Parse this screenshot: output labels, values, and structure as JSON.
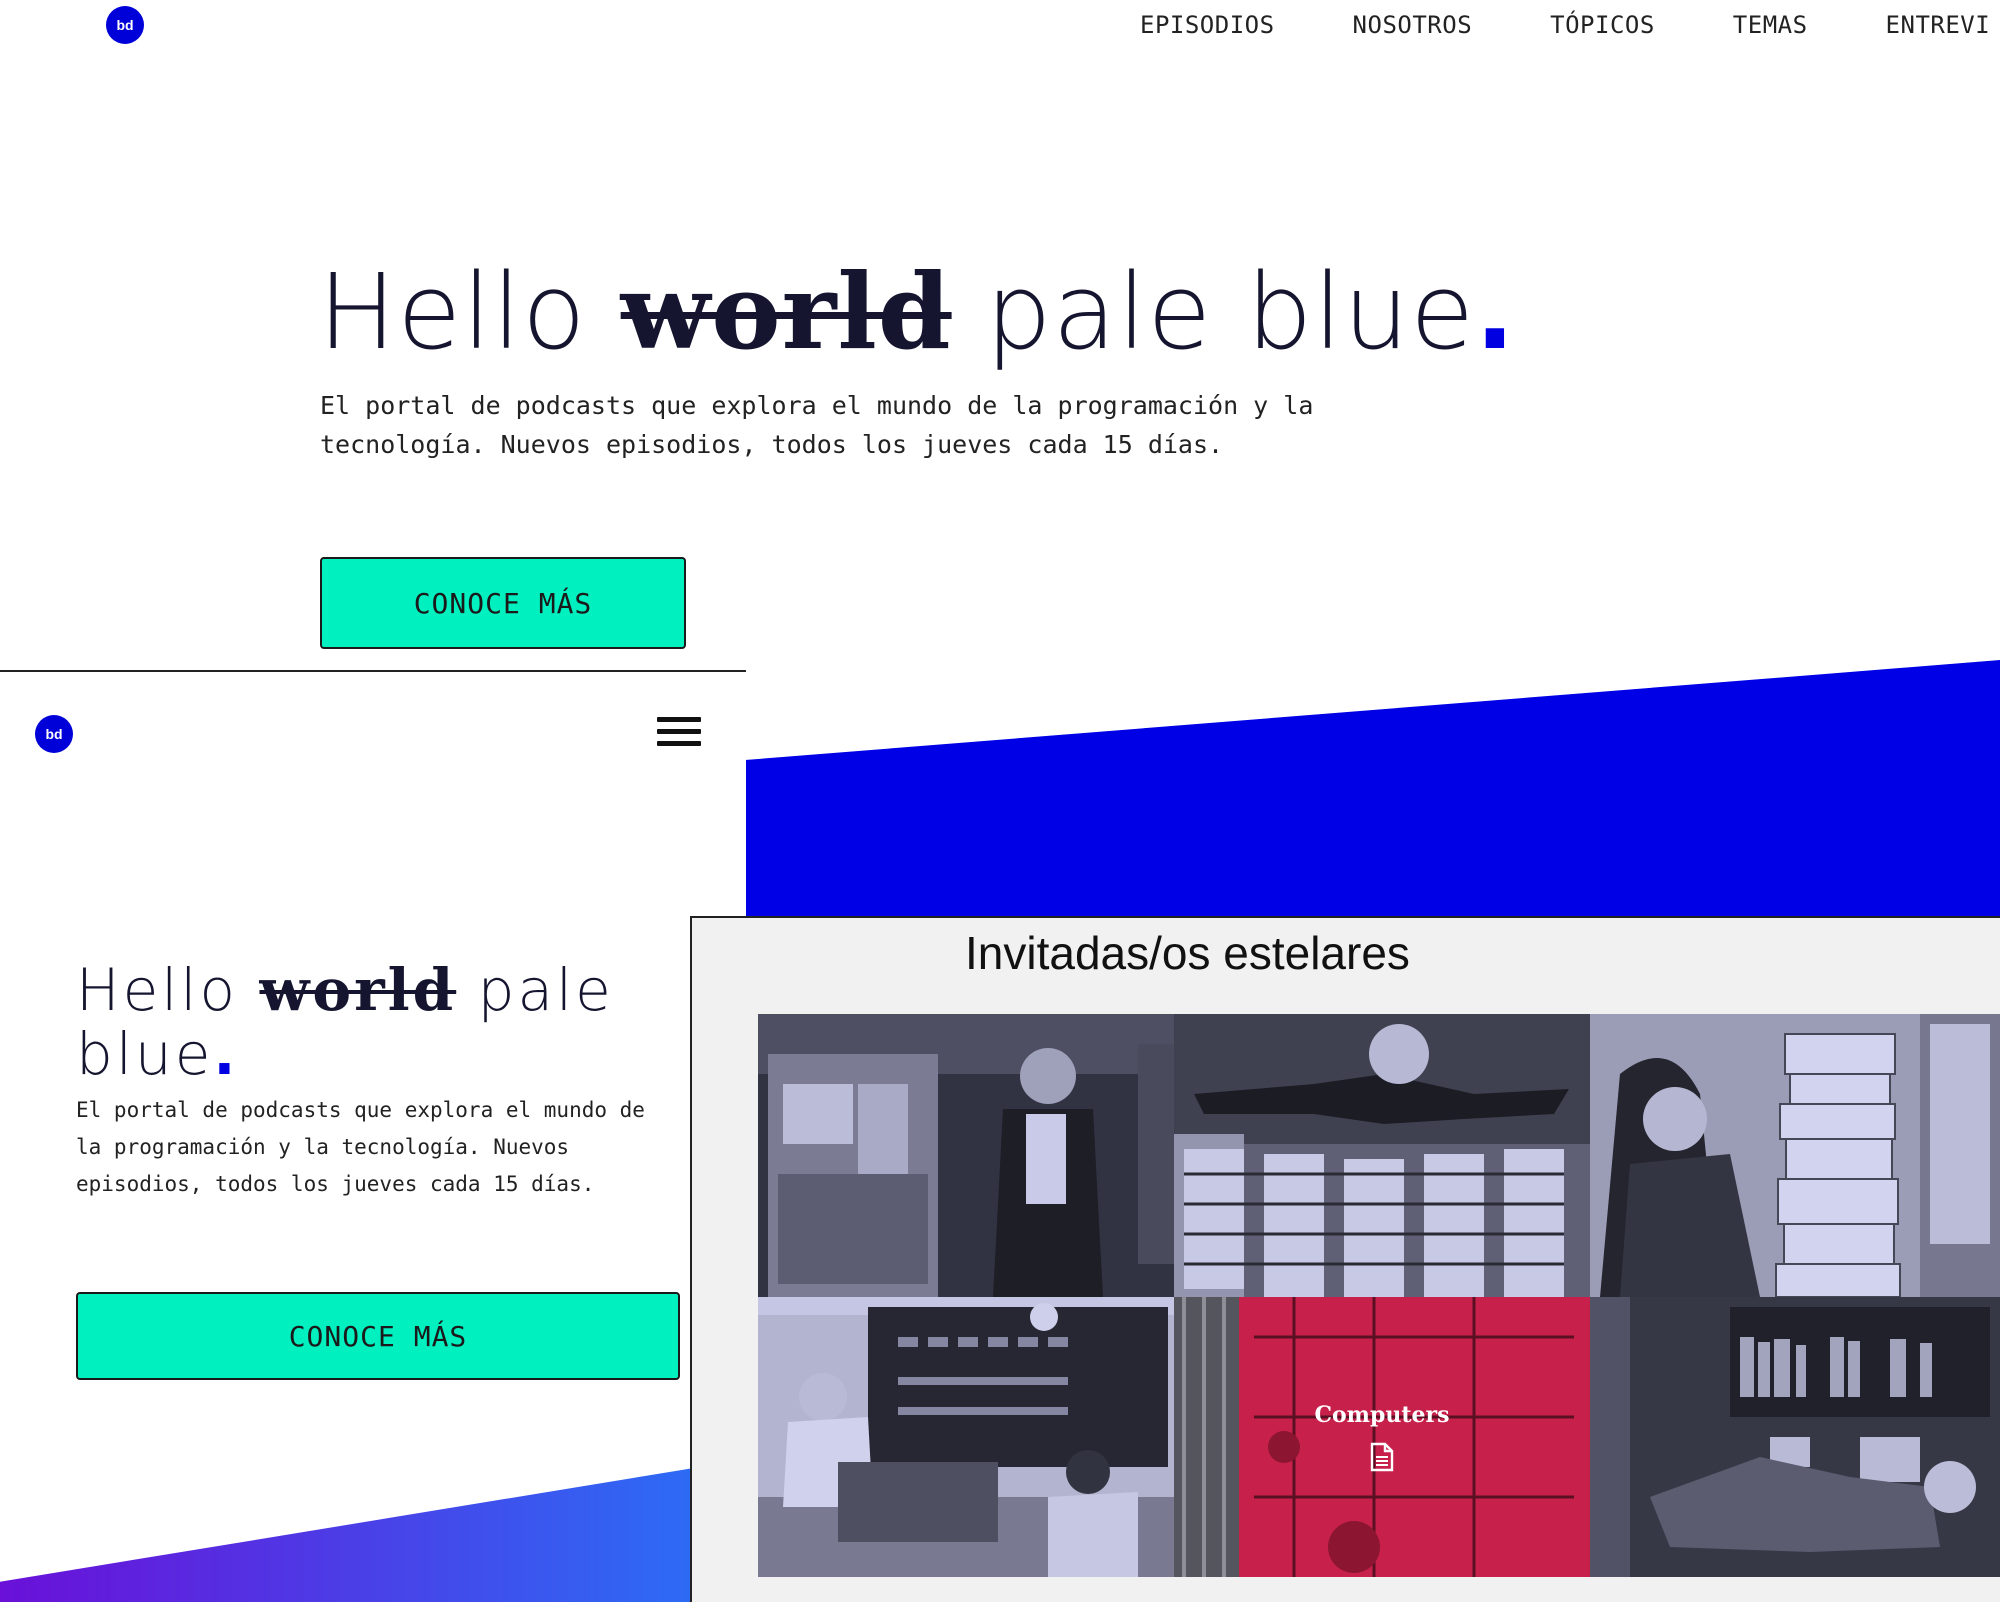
{
  "logo": {
    "text": "bd"
  },
  "nav": {
    "items": [
      {
        "label": "EPISODIOS"
      },
      {
        "label": "NOSOTROS"
      },
      {
        "label": "TÓPICOS"
      },
      {
        "label": "TEMAS"
      },
      {
        "label": "ENTREVI"
      }
    ]
  },
  "hero": {
    "title_start": "Hello ",
    "title_strike": "world",
    "title_end": " pale blue",
    "title_dot": ".",
    "description": "El portal de podcasts que explora el mundo de la programación y la tecnología. Nuevos episodios, todos los jueves cada 15 días.",
    "cta_label": "CONOCE MÁS"
  },
  "mobile": {
    "logo_text": "bd",
    "title_start": "Hello ",
    "title_strike": "world",
    "title_mid": " pale",
    "title_end": "blue",
    "title_dot": ".",
    "description": "El portal de podcasts que explora el mundo de la programación y la tecnología. Nuevos episodios, todos los jueves cada 15 días.",
    "cta_label": "CONOCE MÁS"
  },
  "guests": {
    "title": "Invitadas/os estelares",
    "highlight_caption": "Computers",
    "tiles": [
      {
        "photo": "woman-at-ibm-mainframe"
      },
      {
        "photo": "woman-with-rope-memory-modules"
      },
      {
        "photo": "woman-with-stack-of-code-listings"
      },
      {
        "photo": "women-operating-era-1103-console"
      },
      {
        "photo": "women-wiring-plugboard-computer"
      },
      {
        "photo": "woman-relaxing-among-computers"
      }
    ]
  },
  "colors": {
    "brand_blue": "#0000e6",
    "cta_green": "#00f0c0",
    "highlight_red": "#c7204a"
  }
}
